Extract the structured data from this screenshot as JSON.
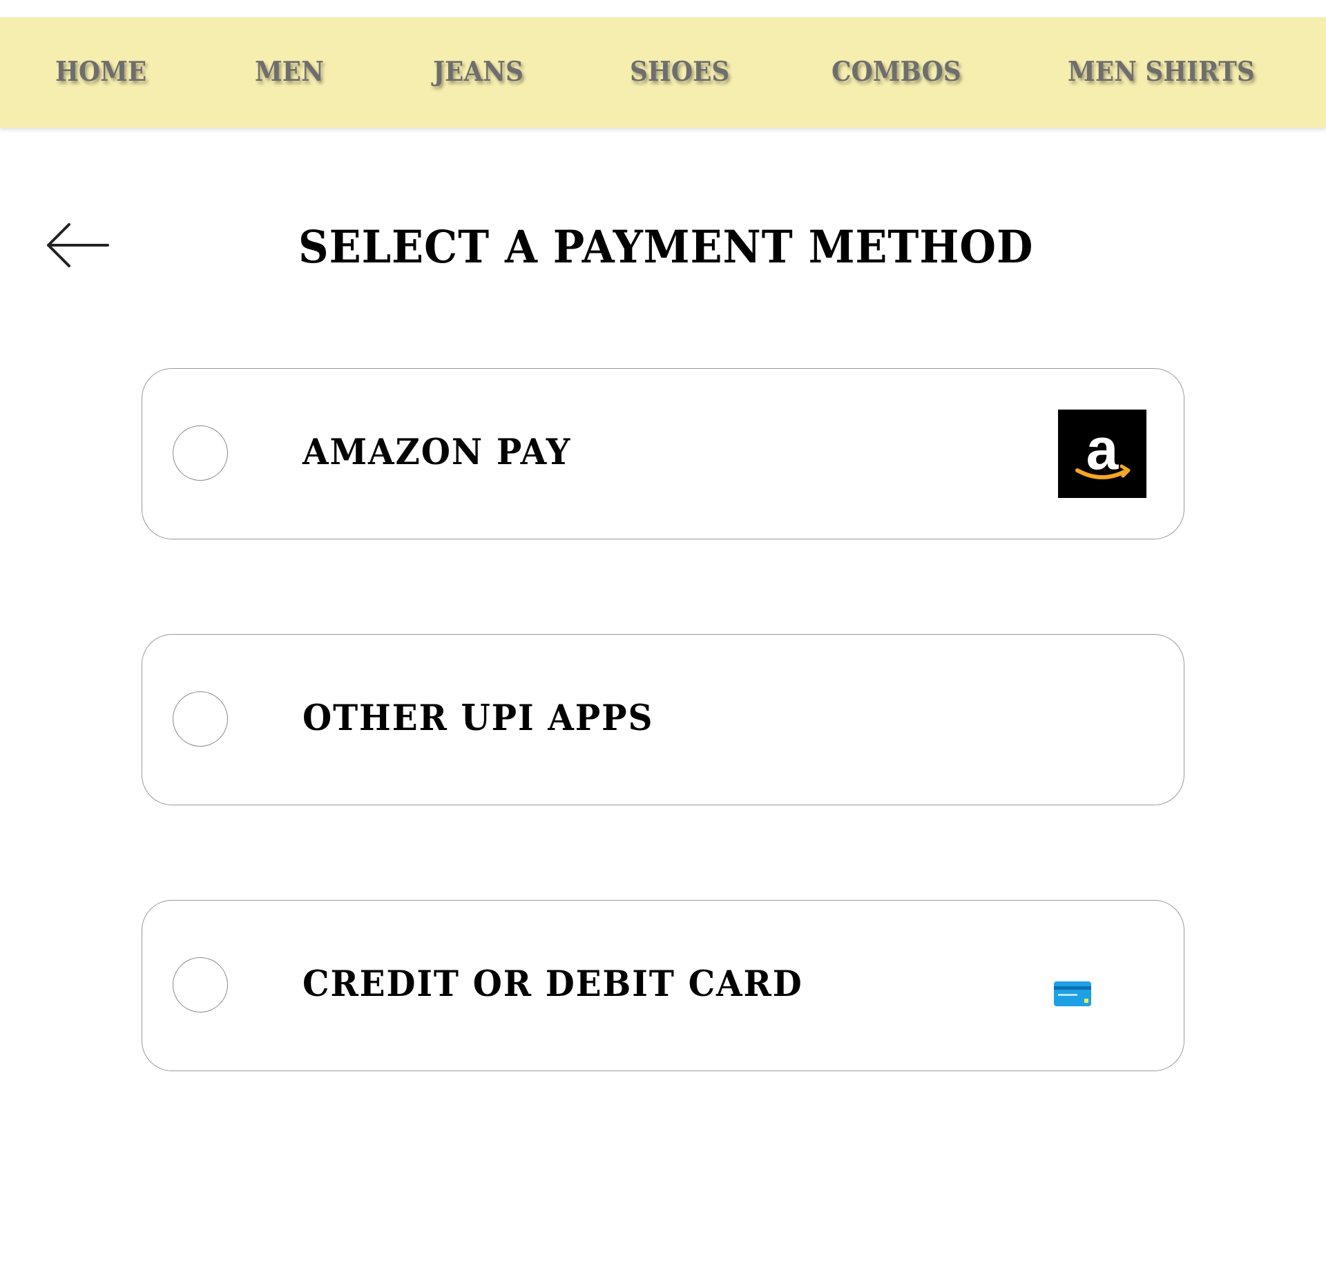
{
  "nav": {
    "items": [
      {
        "label": "HOME"
      },
      {
        "label": "MEN"
      },
      {
        "label": "JEANS"
      },
      {
        "label": "SHOES"
      },
      {
        "label": "COMBOS"
      },
      {
        "label": "MEN SHIRTS"
      }
    ]
  },
  "header": {
    "back_icon": "arrow-left-icon",
    "title": "SELECT A PAYMENT METHOD"
  },
  "payment_options": [
    {
      "label": "AMAZON PAY",
      "icon": "amazon-logo-icon",
      "selected": false
    },
    {
      "label": "OTHER UPI APPS",
      "icon": null,
      "selected": false
    },
    {
      "label": "CREDIT OR DEBIT CARD",
      "icon": "credit-card-icon",
      "selected": false
    }
  ],
  "colors": {
    "nav_background": "#f6eeae",
    "nav_text": "#6e6e6e",
    "card_icon_blue": "#1ea0e6",
    "amazon_orange": "#f5a623"
  }
}
